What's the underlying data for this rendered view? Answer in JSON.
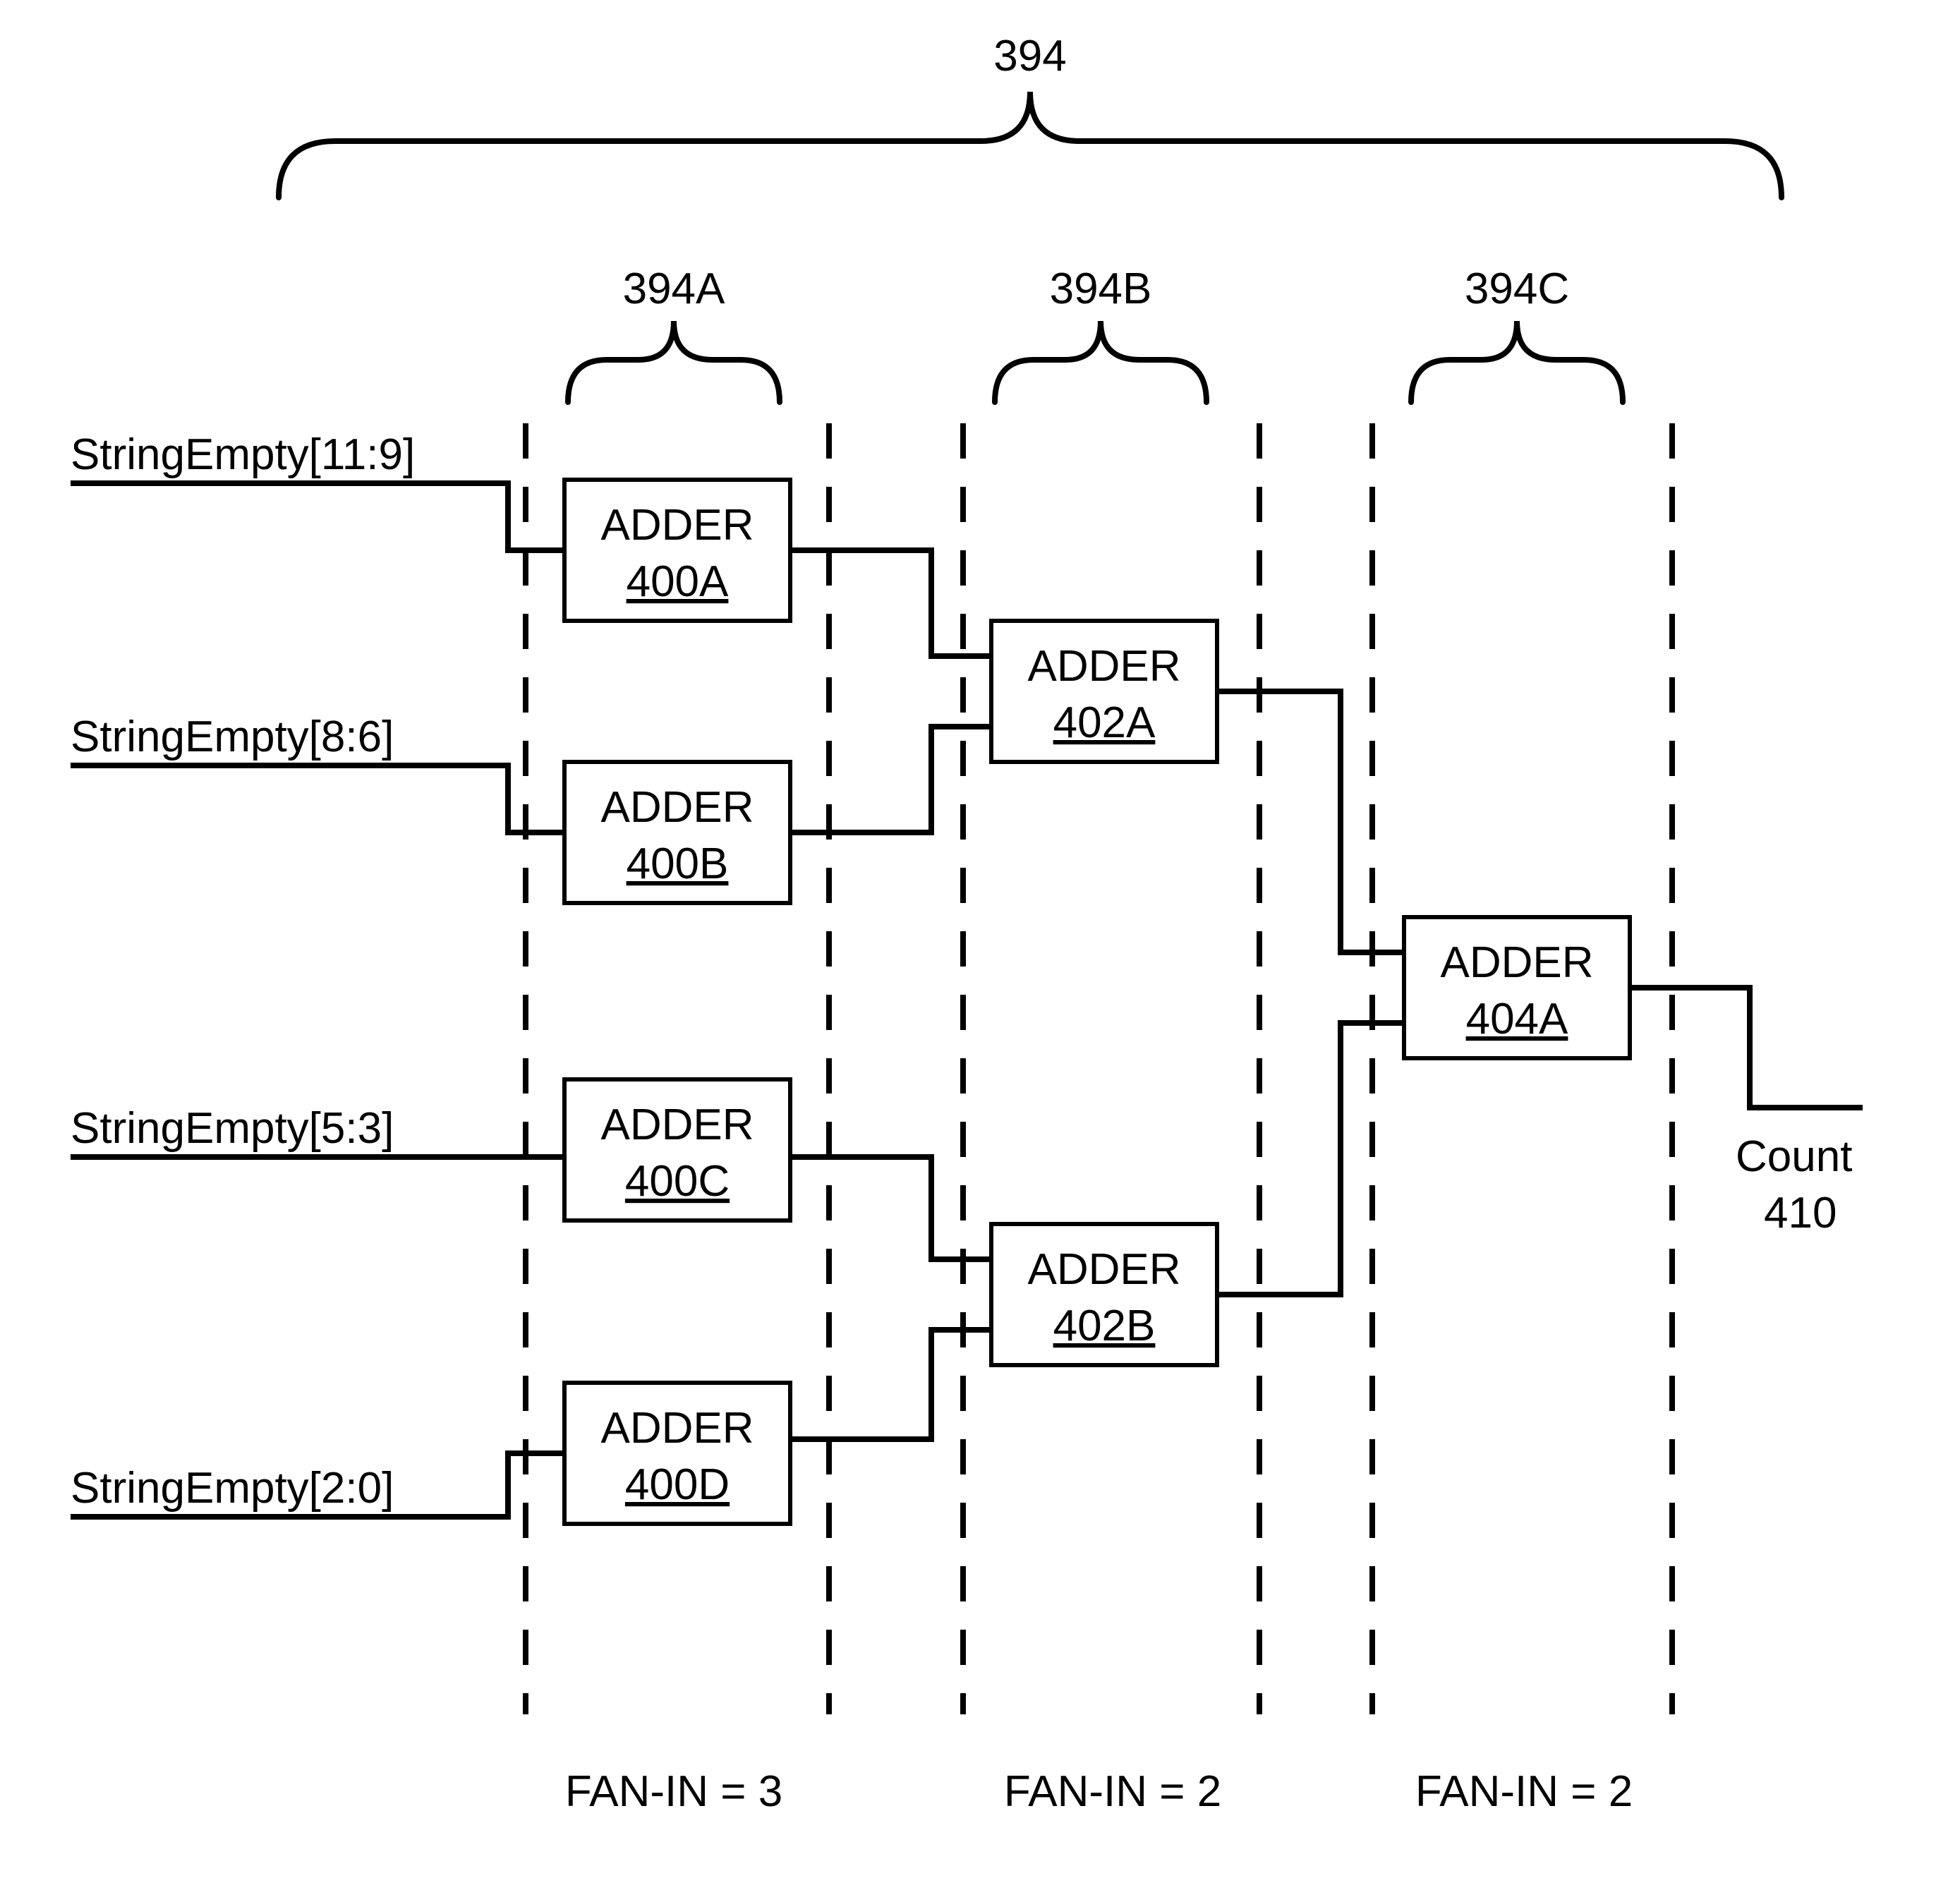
{
  "top_label": "394",
  "stages": {
    "a": {
      "label": "394A",
      "fanin": "FAN-IN = 3"
    },
    "b": {
      "label": "394B",
      "fanin": "FAN-IN = 2"
    },
    "c": {
      "label": "394C",
      "fanin": "FAN-IN = 2"
    }
  },
  "inputs": {
    "i0": "StringEmpty[11:9]",
    "i1": "StringEmpty[8:6]",
    "i2": "StringEmpty[5:3]",
    "i3": "StringEmpty[2:0]"
  },
  "blocks": {
    "a0": {
      "t": "ADDER",
      "r": "400A"
    },
    "a1": {
      "t": "ADDER",
      "r": "400B"
    },
    "a2": {
      "t": "ADDER",
      "r": "400C"
    },
    "a3": {
      "t": "ADDER",
      "r": "400D"
    },
    "b0": {
      "t": "ADDER",
      "r": "402A"
    },
    "b1": {
      "t": "ADDER",
      "r": "402B"
    },
    "c0": {
      "t": "ADDER",
      "r": "404A"
    }
  },
  "output": {
    "name": "Count",
    "ref": "410"
  }
}
